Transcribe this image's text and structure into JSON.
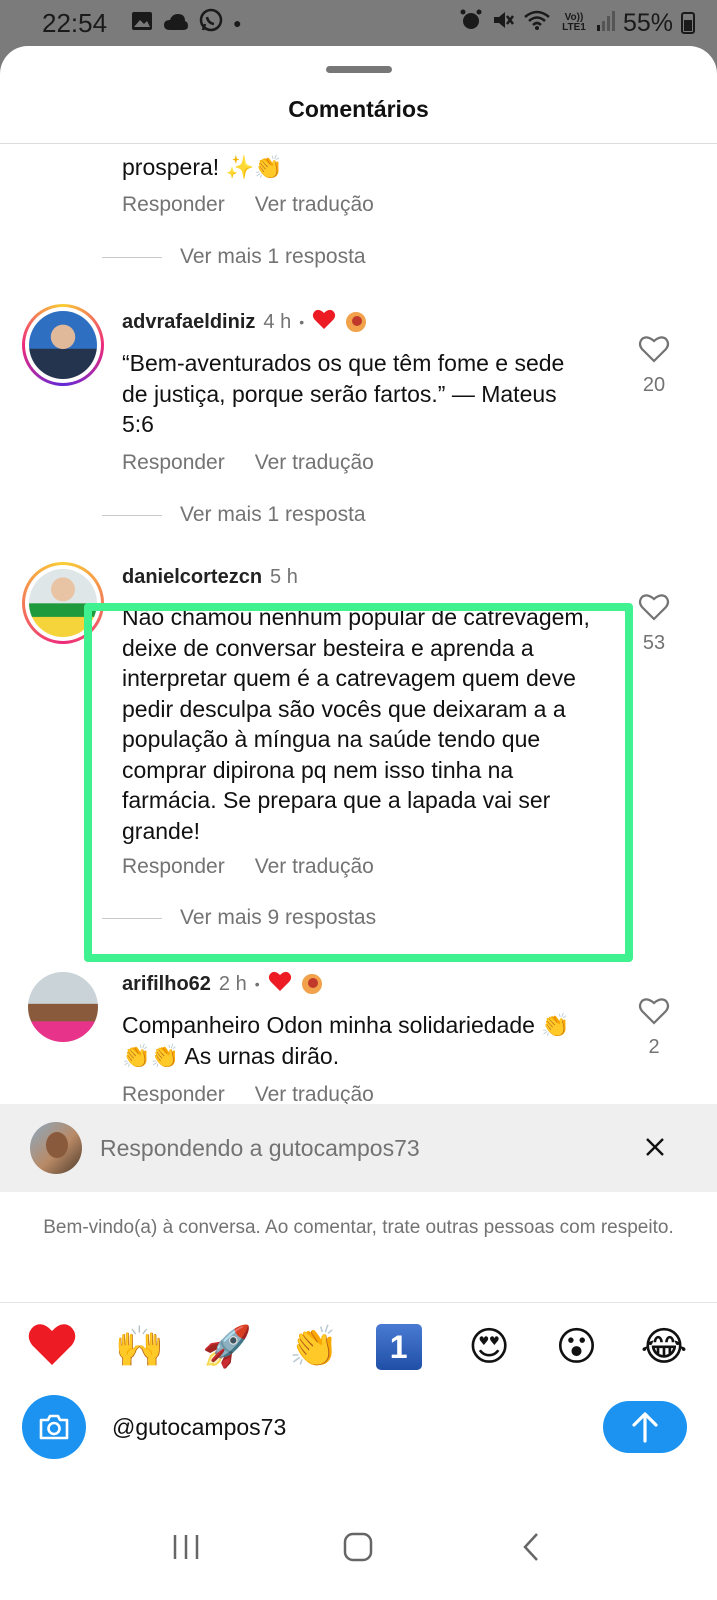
{
  "status_bar": {
    "time": "22:54",
    "battery": "55%",
    "network_label": "Vo)) LTE1"
  },
  "sheet": {
    "title": "Comentários"
  },
  "comments": [
    {
      "text_lines": [
        "prospera! ✨👏"
      ],
      "actions": {
        "reply": "Responder",
        "translate": "Ver tradução"
      },
      "more_replies": "Ver mais 1 resposta"
    },
    {
      "username": "advrafaeldiniz",
      "time": "4 h",
      "text": "“Bem-aventurados os que têm fome e sede de justiça, porque serão fartos.” — Mateus 5:6",
      "likes": "20",
      "actions": {
        "reply": "Responder",
        "translate": "Ver tradução"
      },
      "more_replies": "Ver mais 1 resposta"
    },
    {
      "username": "danielcortezcn",
      "time": "5 h",
      "text": "Não chamou nenhum popular de catrevagem, deixe de conversar besteira e aprenda a interpretar quem é a catrevagem quem deve pedir desculpa são vocês que deixaram a a população à míngua na saúde tendo que comprar dipirona pq nem isso tinha na farmácia. Se prepara que a lapada vai ser grande!",
      "likes": "53",
      "actions": {
        "reply": "Responder",
        "translate": "Ver tradução"
      },
      "more_replies": "Ver mais 9 respostas"
    },
    {
      "username": "arifilho62",
      "time": "2 h",
      "text": "Companheiro Odon minha solidariedade 👏👏👏 As urnas dirão.",
      "likes": "2",
      "actions": {
        "reply": "Responder",
        "translate": "Ver tradução"
      }
    }
  ],
  "reply_bar": {
    "text": "Respondendo a gutocampos73",
    "close_icon": "close-icon"
  },
  "welcome_message": "Bem-vindo(a) à conversa. Ao comentar, trate outras pessoas com respeito.",
  "emoji_bar": [
    "❤️",
    "🙌",
    "🚀",
    "👏",
    "1",
    "😍",
    "😮",
    "😂"
  ],
  "composer": {
    "value": "@gutocampos73"
  },
  "colors": {
    "accent": "#1c93f0",
    "highlight": "#3ff28f",
    "muted": "#737373",
    "heart_red": "#ed1c24"
  }
}
